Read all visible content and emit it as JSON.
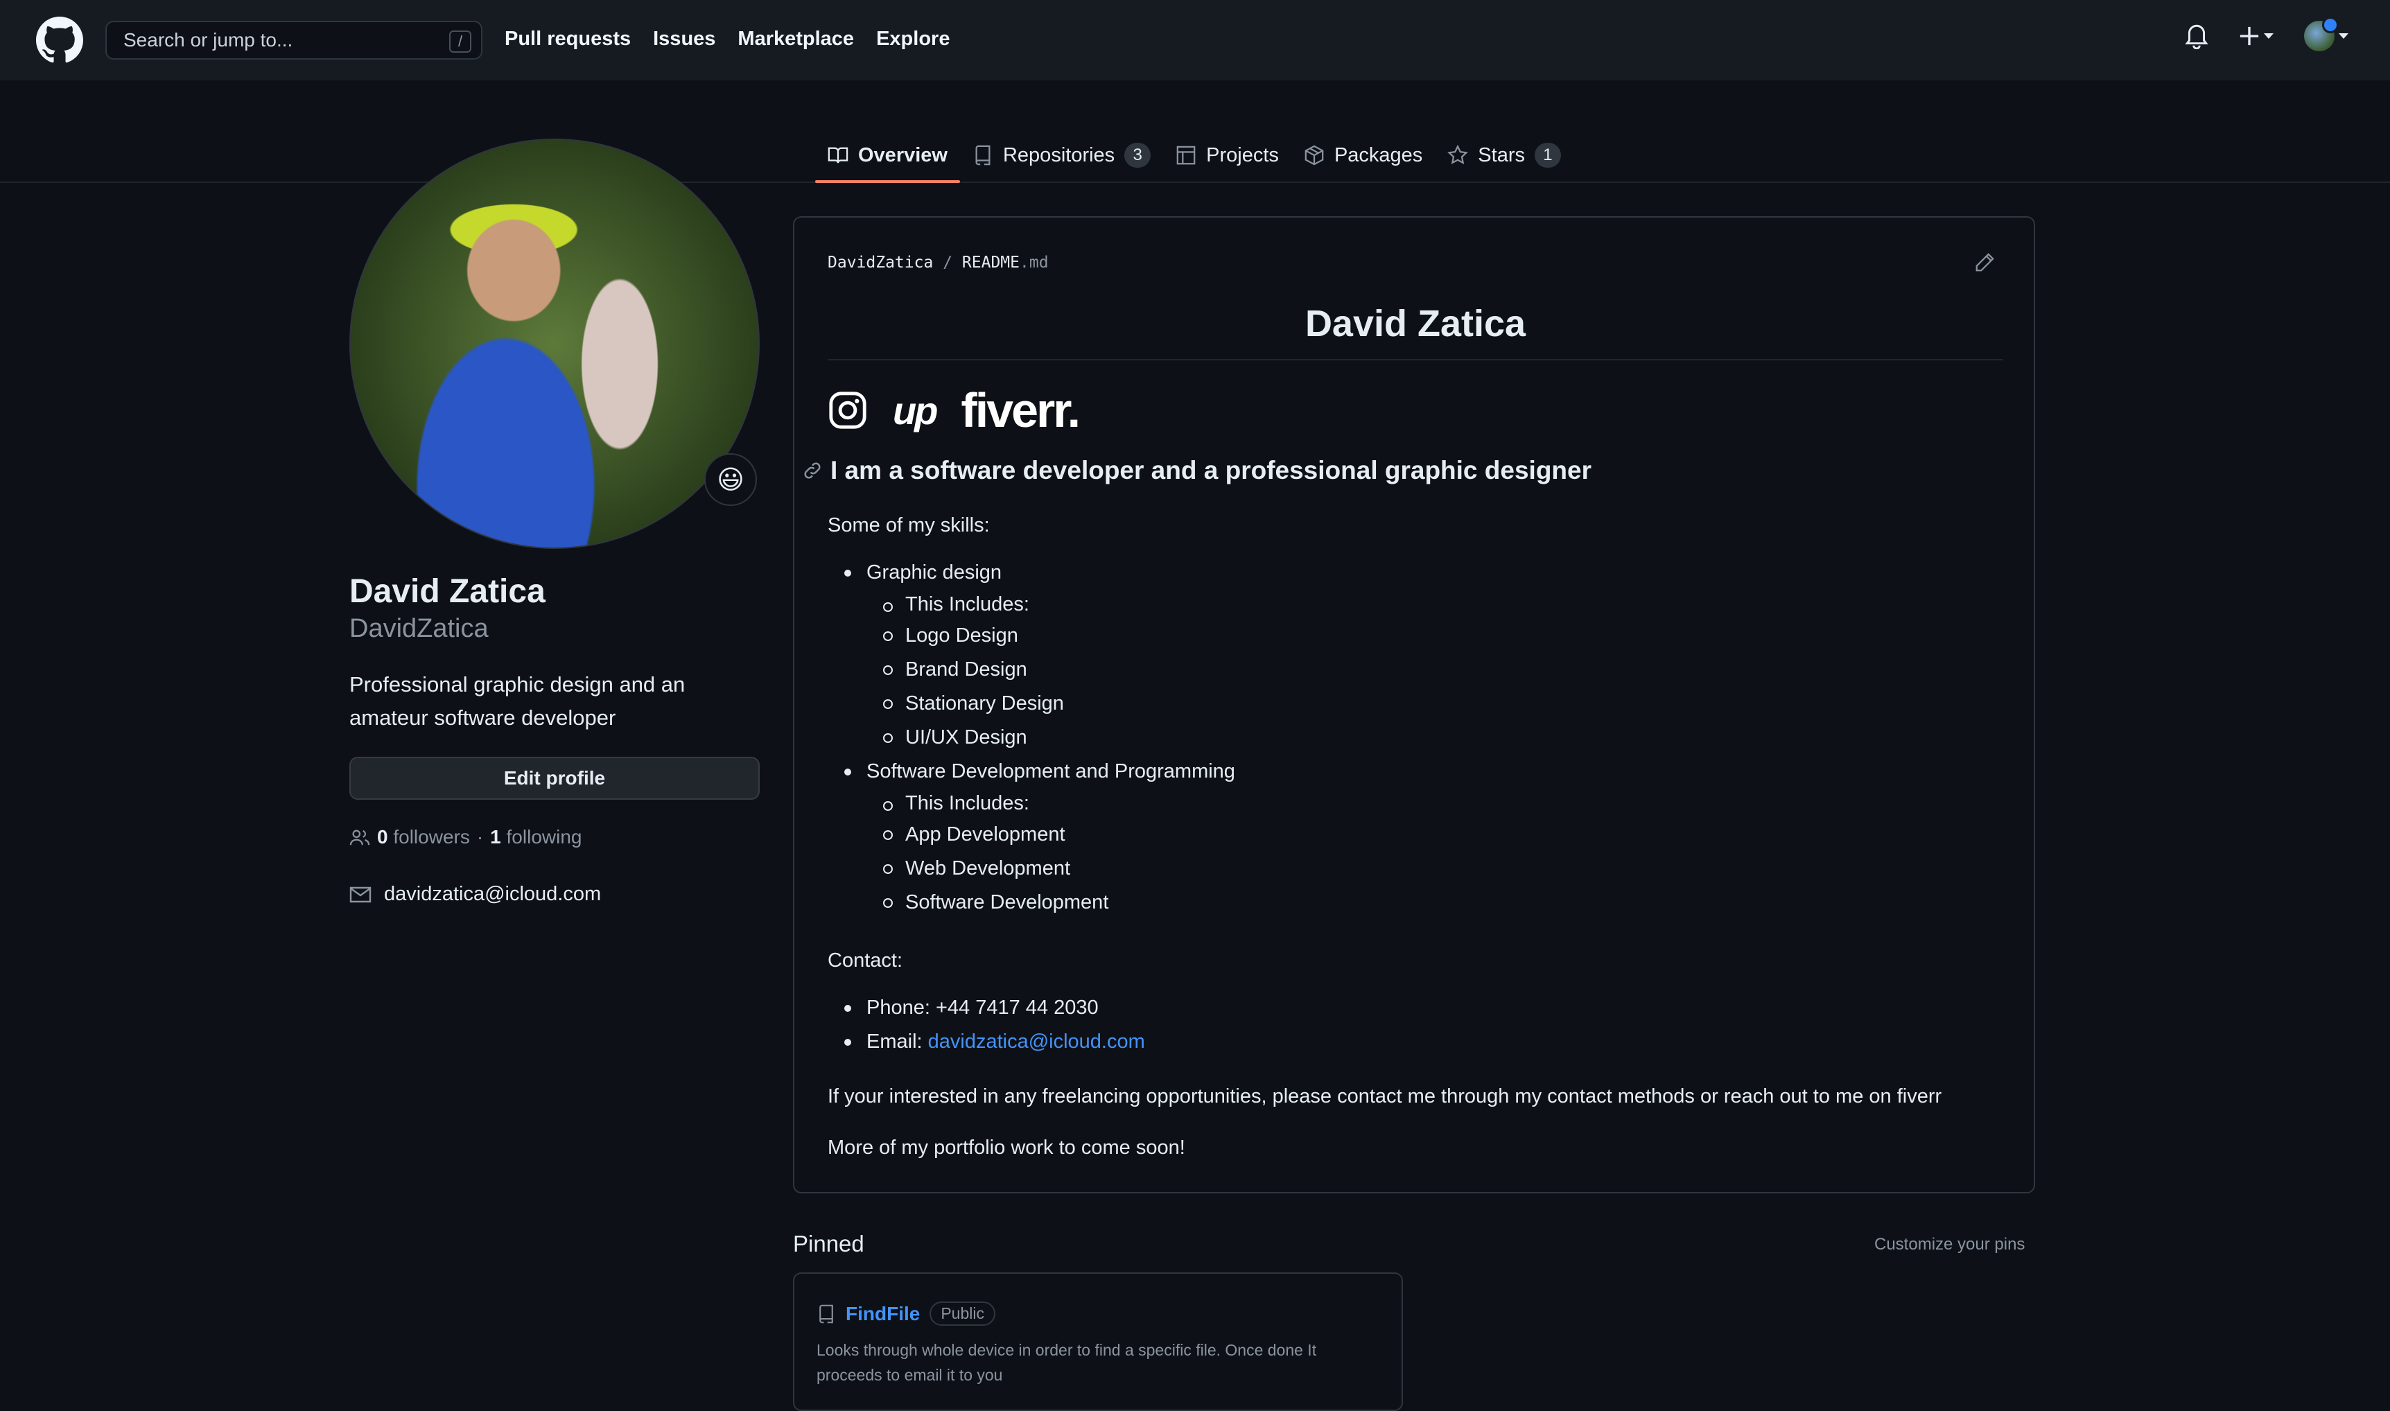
{
  "header": {
    "search_placeholder": "Search or jump to...",
    "search_shortcut": "/",
    "nav": [
      "Pull requests",
      "Issues",
      "Marketplace",
      "Explore"
    ]
  },
  "tabs": [
    {
      "label": "Overview",
      "count": null,
      "icon": "book-icon",
      "active": true
    },
    {
      "label": "Repositories",
      "count": "3",
      "icon": "repo-icon"
    },
    {
      "label": "Projects",
      "count": null,
      "icon": "table-icon"
    },
    {
      "label": "Packages",
      "count": null,
      "icon": "package-icon"
    },
    {
      "label": "Stars",
      "count": "1",
      "icon": "star-icon"
    }
  ],
  "profile": {
    "name": "David Zatica",
    "login": "DavidZatica",
    "bio": "Professional graphic design and an amateur software developer",
    "edit_label": "Edit profile",
    "followers_count": "0",
    "followers_label": "followers",
    "separator": "·",
    "following_count": "1",
    "following_label": "following",
    "email": "davidzatica@icloud.com",
    "status_emoji": "😃"
  },
  "readme": {
    "path_user": "DavidZatica",
    "path_sep": "/",
    "path_file": "README",
    "path_ext": ".md",
    "title": "David Zatica",
    "social": {
      "upwork": "up",
      "fiverr": "fiverr."
    },
    "heading": "I am a software developer and a professional graphic designer",
    "skills_intro": "Some of my skills:",
    "skills": [
      {
        "name": "Graphic design",
        "items": [
          "This Includes:",
          "Logo Design",
          "Brand Design",
          "Stationary Design",
          "UI/UX Design"
        ]
      },
      {
        "name": "Software Development and Programming",
        "items": [
          "This Includes:",
          "App Development",
          "Web Development",
          "Software Development"
        ]
      }
    ],
    "contact_intro": "Contact:",
    "phone": "Phone: +44 7417 44 2030",
    "email_label": "Email: ",
    "email_link": "davidzatica@icloud.com",
    "freelance": "If your interested in any freelancing opportunities, please contact me through my contact methods or reach out to me on fiverr",
    "portfolio": "More of my portfolio work to come soon!"
  },
  "pinned": {
    "title": "Pinned",
    "customize": "Customize your pins",
    "repos": [
      {
        "name": "FindFile",
        "visibility": "Public",
        "description": "Looks through whole device in order to find a specific file. Once done It proceeds to email it to you"
      }
    ]
  },
  "colors": {
    "accent_tab": "#f78166",
    "link": "#4493f8",
    "bg": "#0d1117",
    "header_bg": "#161b22"
  }
}
